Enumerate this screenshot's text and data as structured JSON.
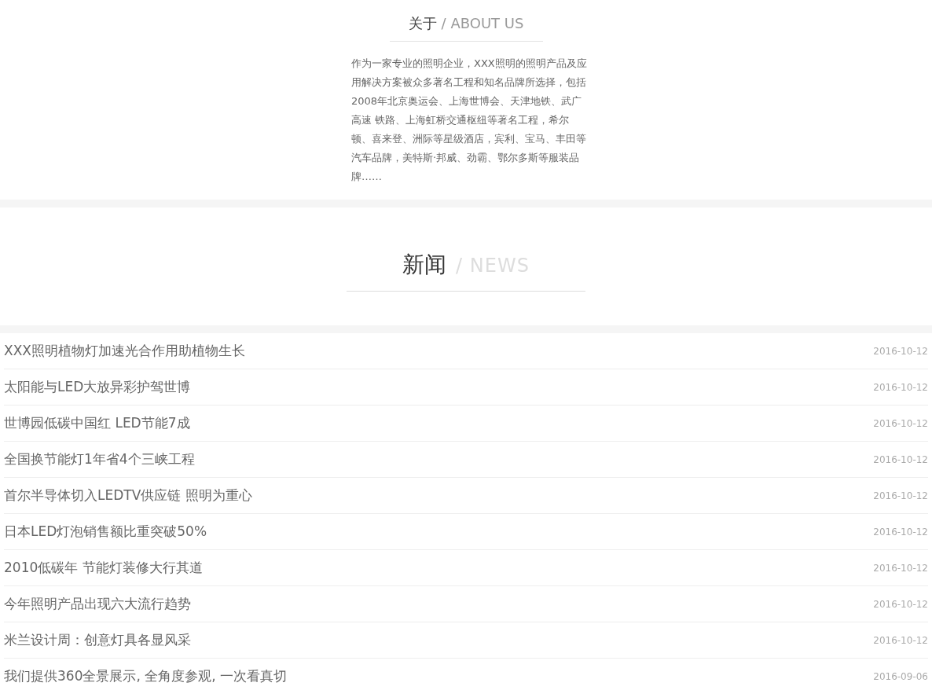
{
  "about": {
    "title": "关于",
    "subtitle": "/ ABOUT US",
    "text": "作为一家专业的照明企业，XXX照明的照明产品及应用解决方案被众多著名工程和知名品牌所选择，包括2008年北京奥运会、上海世博会、天津地铁、武广高速 铁路、上海虹桥交通枢纽等著名工程，希尔顿、喜来登、洲际等星级酒店，宾利、宝马、丰田等汽车品牌，美特斯·邦威、劲霸、鄂尔多斯等服装品牌……"
  },
  "news": {
    "title": "新闻",
    "subtitle": "/ NEWS",
    "items": [
      {
        "title": "XXX照明植物灯加速光合作用助植物生长",
        "date": "2016-10-12"
      },
      {
        "title": "太阳能与LED大放异彩护驾世博",
        "date": "2016-10-12"
      },
      {
        "title": "世博园低碳中国红 LED节能7成",
        "date": "2016-10-12"
      },
      {
        "title": "全国换节能灯1年省4个三峡工程",
        "date": "2016-10-12"
      },
      {
        "title": "首尔半导体切入LEDTV供应链 照明为重心",
        "date": "2016-10-12"
      },
      {
        "title": "日本LED灯泡销售额比重突破50%",
        "date": "2016-10-12"
      },
      {
        "title": "2010低碳年 节能灯装修大行其道",
        "date": "2016-10-12"
      },
      {
        "title": "今年照明产品出现六大流行趋势",
        "date": "2016-10-12"
      },
      {
        "title": "米兰设计周：创意灯具各显风采",
        "date": "2016-10-12"
      },
      {
        "title": "我们提供360全景展示, 全角度参观, 一次看真切",
        "date": "2016-09-06"
      }
    ]
  }
}
